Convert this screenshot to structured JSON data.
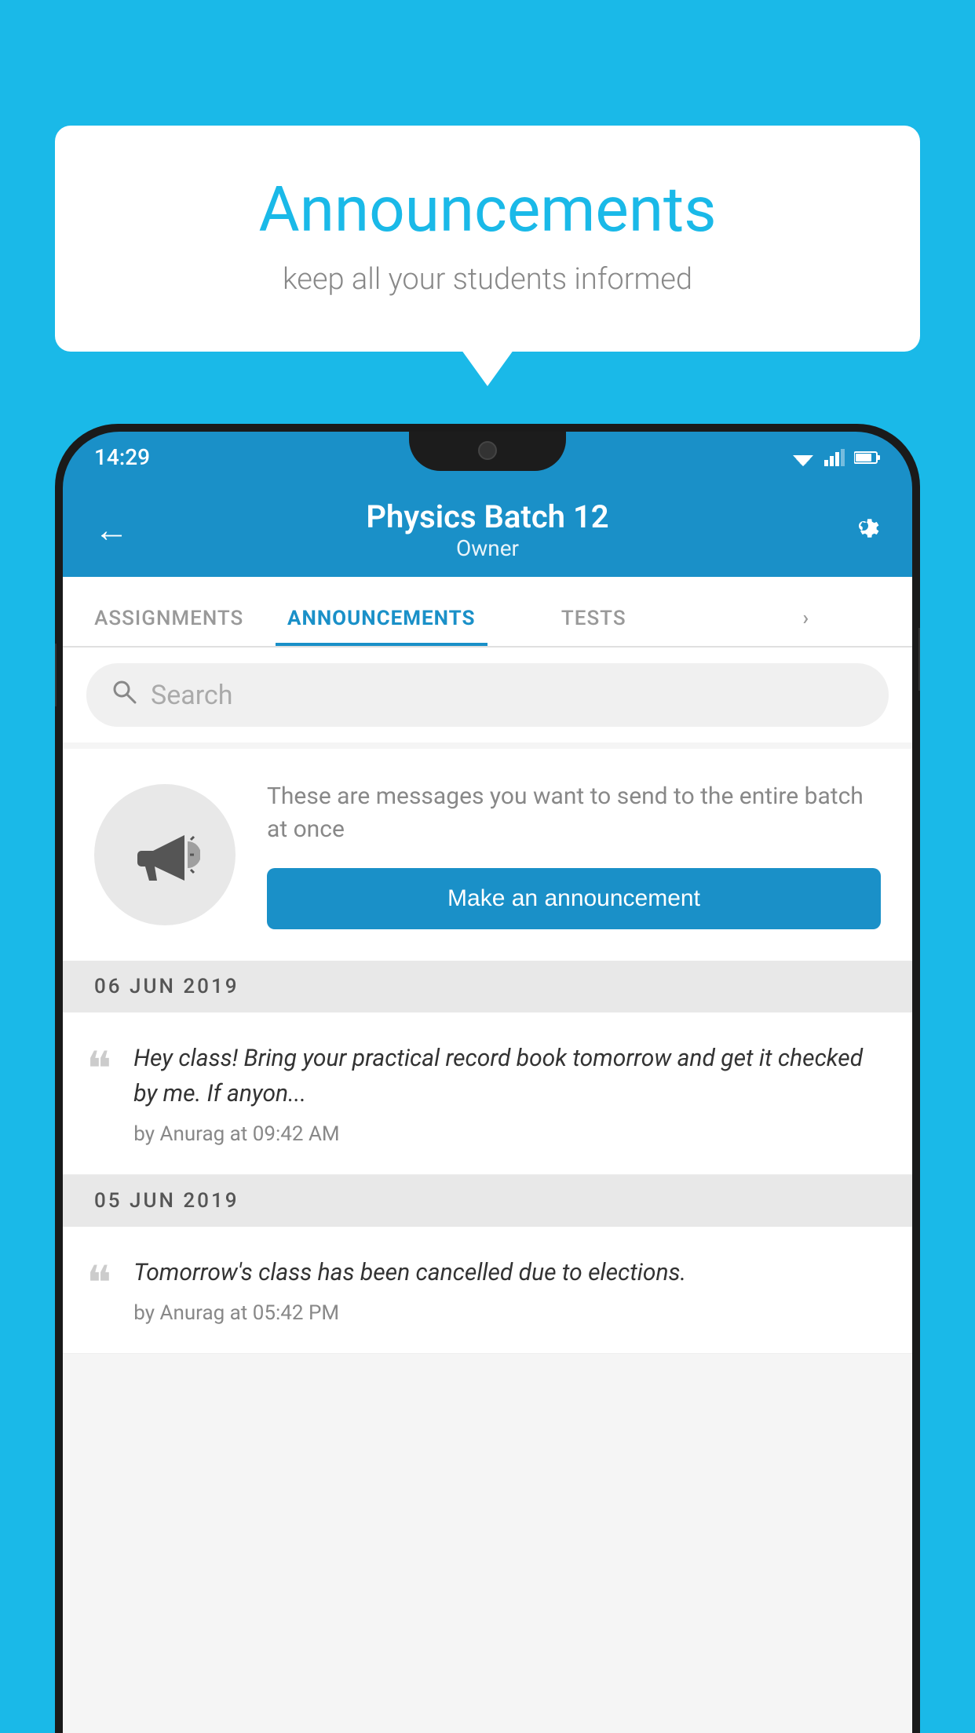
{
  "background": {
    "color": "#1ab9e8"
  },
  "speech_bubble": {
    "title": "Announcements",
    "subtitle": "keep all your students informed"
  },
  "status_bar": {
    "time": "14:29"
  },
  "app_bar": {
    "title": "Physics Batch 12",
    "subtitle": "Owner",
    "back_label": "←"
  },
  "tabs": [
    {
      "label": "ASSIGNMENTS",
      "active": false
    },
    {
      "label": "ANNOUNCEMENTS",
      "active": true
    },
    {
      "label": "TESTS",
      "active": false
    },
    {
      "label": "...",
      "active": false
    }
  ],
  "search": {
    "placeholder": "Search"
  },
  "promo": {
    "description": "These are messages you want to send to the entire batch at once",
    "button_label": "Make an announcement"
  },
  "announcement_groups": [
    {
      "date": "06  JUN  2019",
      "items": [
        {
          "text": "Hey class! Bring your practical record book tomorrow and get it checked by me. If anyon...",
          "author": "by Anurag at 09:42 AM"
        }
      ]
    },
    {
      "date": "05  JUN  2019",
      "items": [
        {
          "text": "Tomorrow's class has been cancelled due to elections.",
          "author": "by Anurag at 05:42 PM"
        }
      ]
    }
  ]
}
